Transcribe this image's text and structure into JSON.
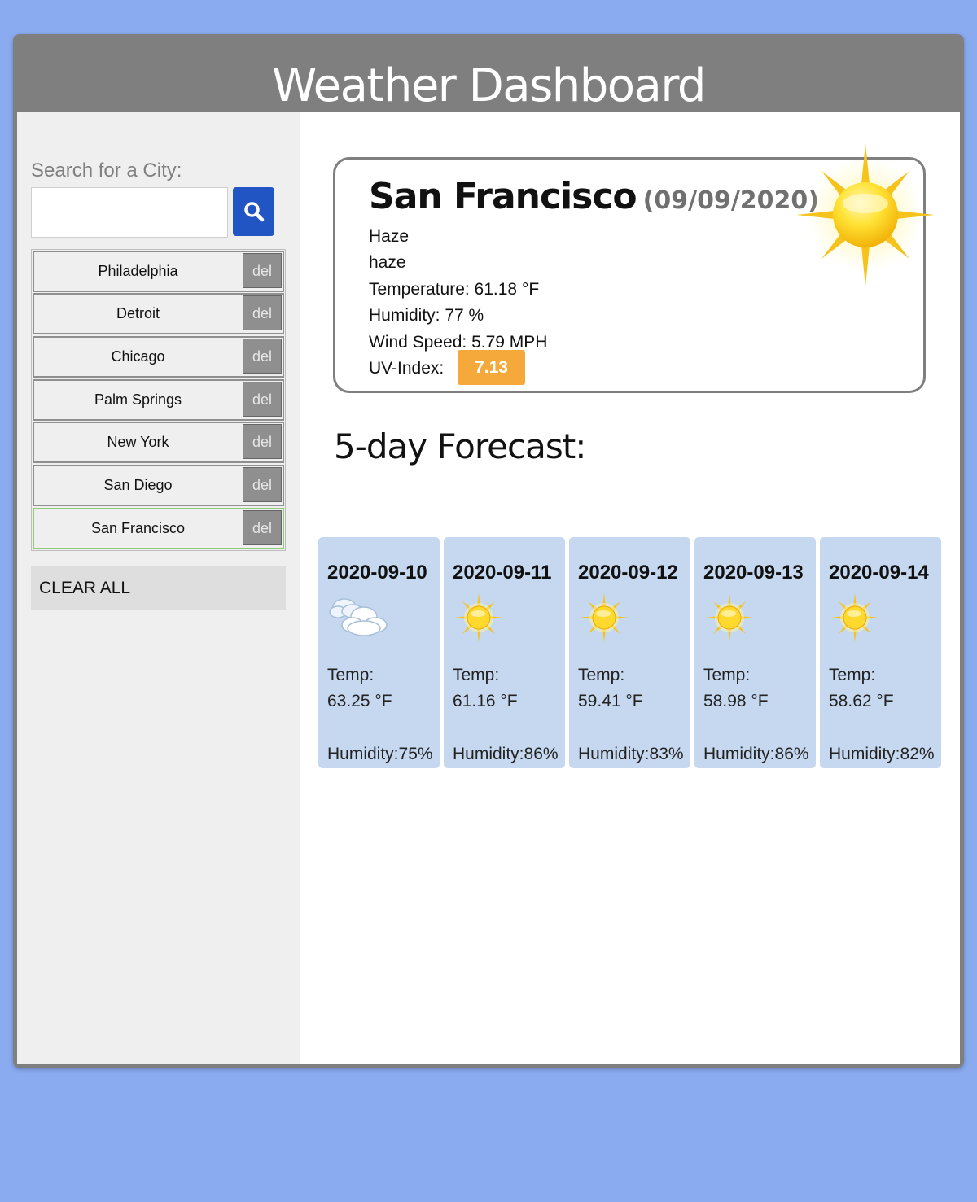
{
  "header": {
    "title": "Weather Dashboard"
  },
  "sidebar": {
    "search_label": "Search for a City:",
    "search_value": "",
    "search_placeholder": "",
    "search_icon": "search-icon",
    "delete_label": "del",
    "cities": [
      {
        "name": "Philadelphia",
        "active": false
      },
      {
        "name": "Detroit",
        "active": false
      },
      {
        "name": "Chicago",
        "active": false
      },
      {
        "name": "Palm Springs",
        "active": false
      },
      {
        "name": "New York",
        "active": false
      },
      {
        "name": "San Diego",
        "active": false
      },
      {
        "name": "San Francisco",
        "active": true
      }
    ],
    "clear_all_label": "CLEAR ALL"
  },
  "current": {
    "city": "San Francisco",
    "date": "(09/09/2020)",
    "main": "Haze",
    "description": "haze",
    "temperature": "Temperature: 61.18 °F",
    "humidity": "Humidity: 77 %",
    "wind_speed": "Wind Speed: 5.79 MPH",
    "uv_label": "UV-Index:",
    "uv_value": "7.13",
    "uv_color": "#f4a93a",
    "icon": "sun-icon"
  },
  "forecast": {
    "title": "5-day Forecast:",
    "card_color": "#c5d8ef",
    "temp_label": "Temp:",
    "days": [
      {
        "date": "2020-09-10",
        "icon": "cloud-icon",
        "temp": "63.25 °F",
        "humidity": "Humidity:75%"
      },
      {
        "date": "2020-09-11",
        "icon": "sun-icon",
        "temp": "61.16 °F",
        "humidity": "Humidity:86%"
      },
      {
        "date": "2020-09-12",
        "icon": "sun-icon",
        "temp": "59.41 °F",
        "humidity": "Humidity:83%"
      },
      {
        "date": "2020-09-13",
        "icon": "sun-icon",
        "temp": "58.98 °F",
        "humidity": "Humidity:86%"
      },
      {
        "date": "2020-09-14",
        "icon": "sun-icon",
        "temp": "58.62 °F",
        "humidity": "Humidity:82%"
      }
    ]
  }
}
